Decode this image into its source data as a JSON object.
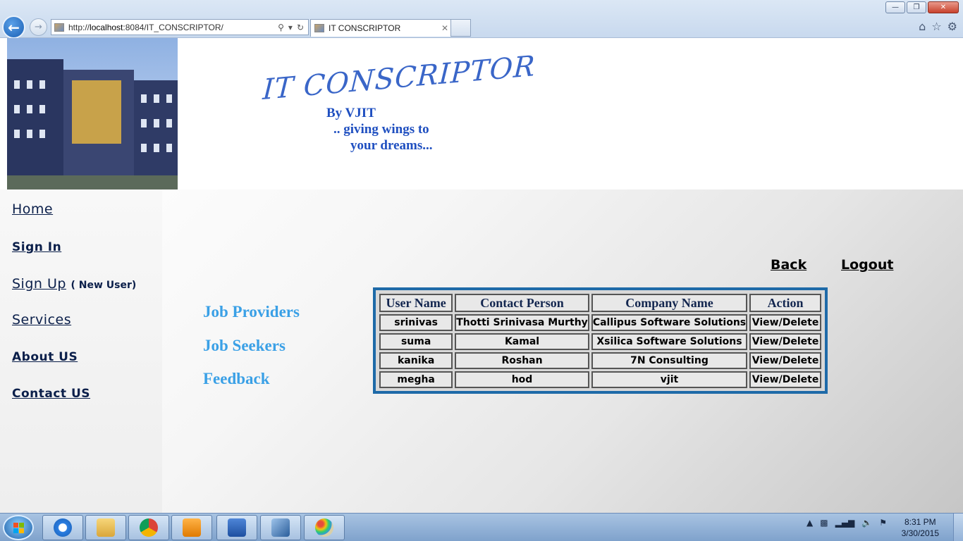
{
  "browser": {
    "address_prefix": "http://",
    "address_host": "localhost",
    "address_rest": ":8084/IT_CONSCRIPTOR/",
    "tab_title": "IT CONSCRIPTOR",
    "window_buttons": [
      "minimize",
      "restore",
      "close"
    ]
  },
  "header": {
    "logo_text": "IT CONSCRIPTOR",
    "byline": "By VJIT",
    "tagline_1": ".. giving wings to",
    "tagline_2": "your dreams..."
  },
  "sidebar": {
    "items": [
      {
        "label": "Home"
      },
      {
        "label": "Sign In"
      },
      {
        "label": "Sign Up",
        "note": "( New User)"
      },
      {
        "label": "Services"
      },
      {
        "label": "About US"
      },
      {
        "label": "Contact US"
      }
    ]
  },
  "admin_menu": {
    "items": [
      {
        "label": "Job Providers"
      },
      {
        "label": "Job Seekers"
      },
      {
        "label": "Feedback"
      }
    ]
  },
  "top_links": {
    "back": "Back",
    "logout": "Logout"
  },
  "table": {
    "headers": [
      "User Name",
      "Contact Person",
      "Company Name",
      "Action"
    ],
    "rows": [
      [
        "srinivas",
        "Thotti Srinivasa Murthy",
        "Callipus Software Solutions",
        "View/Delete"
      ],
      [
        "suma",
        "Kamal",
        "Xsilica Software Solutions",
        "View/Delete"
      ],
      [
        "kanika",
        "Roshan",
        "7N Consulting",
        "View/Delete"
      ],
      [
        "megha",
        "hod",
        "vjit",
        "View/Delete"
      ]
    ]
  },
  "taskbar": {
    "apps": [
      "internet-explorer",
      "file-explorer",
      "chrome",
      "media-player",
      "word",
      "virtualbox",
      "paint"
    ],
    "time": "8:31 PM",
    "date": "3/30/2015"
  },
  "colors": {
    "accent_link": "#3aa0e6",
    "table_border": "#1e6aa8",
    "header_blue": "#1f4fc0"
  }
}
